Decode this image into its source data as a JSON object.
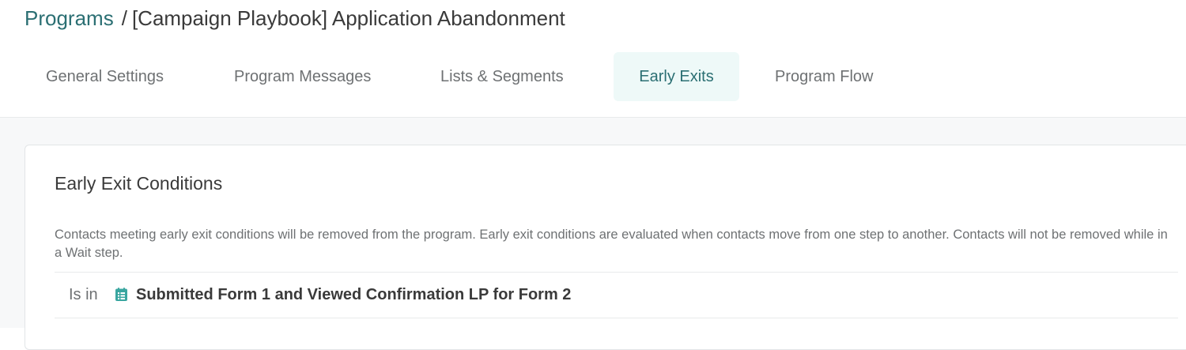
{
  "breadcrumb": {
    "parent": "Programs",
    "separator": "/",
    "current": "[Campaign Playbook] Application Abandonment"
  },
  "tabs": [
    {
      "label": "General Settings",
      "active": false
    },
    {
      "label": "Program Messages",
      "active": false
    },
    {
      "label": "Lists & Segments",
      "active": false
    },
    {
      "label": "Early Exits",
      "active": true
    },
    {
      "label": "Program Flow",
      "active": false
    }
  ],
  "card": {
    "title": "Early Exit Conditions",
    "description": "Contacts meeting early exit conditions will be removed from the program. Early exit conditions are evaluated when contacts move from one step to another. Contacts will not be removed while in a Wait step.",
    "conditions": [
      {
        "operator": "Is in",
        "icon": "list-icon",
        "value": "Submitted Form 1 and Viewed Confirmation LP for Form 2"
      }
    ]
  },
  "colors": {
    "accent": "#2b6f73",
    "active_tab_bg": "#eef9f8",
    "text_dark": "#3a3a3a",
    "text_muted": "#6e7173",
    "page_bg": "#f7f8f9"
  }
}
